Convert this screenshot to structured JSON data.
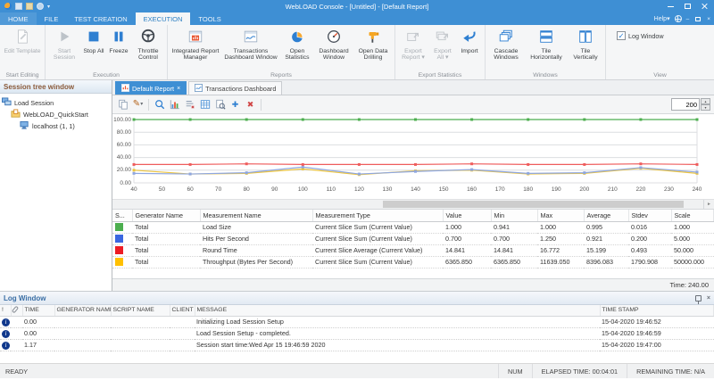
{
  "icons": {
    "caret_down": "▾",
    "caret_up": "▴",
    "close": "×",
    "check": "✓",
    "plus": "✚",
    "cross": "✖",
    "pencil": "✎",
    "info": "i",
    "arrow_right": "►",
    "minimize": "–"
  },
  "titlebar": {
    "title": "WebLOAD Console - [Untitled] - [Default Report]"
  },
  "ribbon": {
    "tabs": [
      {
        "label": "HOME"
      },
      {
        "label": "FILE"
      },
      {
        "label": "TEST CREATION"
      },
      {
        "label": "EXECUTION",
        "active": true
      },
      {
        "label": "TOOLS"
      }
    ],
    "help_label": "Help",
    "groups": [
      {
        "label": "Start Editing",
        "buttons": [
          {
            "label": "Edit Template",
            "disabled": true
          }
        ]
      },
      {
        "label": "Execution",
        "buttons": [
          {
            "label": "Start Session",
            "disabled": true
          },
          {
            "label": "Stop All"
          },
          {
            "label": "Freeze"
          },
          {
            "label": "Throttle Control"
          }
        ]
      },
      {
        "label": "Reports",
        "buttons": [
          {
            "label": "Integrated Report Manager"
          },
          {
            "label": "Transactions Dashboard Window"
          },
          {
            "label": "Open Statistics"
          },
          {
            "label": "Dashboard Window"
          },
          {
            "label": "Open Data Drilling"
          }
        ]
      },
      {
        "label": "Export Statistics",
        "buttons": [
          {
            "label": "Export Report ▾",
            "disabled": true
          },
          {
            "label": "Export All ▾",
            "disabled": true
          },
          {
            "label": "Import"
          }
        ]
      },
      {
        "label": "Windows",
        "buttons": [
          {
            "label": "Cascade Windows"
          },
          {
            "label": "Tile Horizontally"
          },
          {
            "label": "Tile Vertically"
          }
        ]
      },
      {
        "label": "View",
        "checkbox": {
          "label": "Log Window",
          "checked": true
        }
      }
    ]
  },
  "sidebar": {
    "title": "Session tree window",
    "tree": [
      {
        "label": "Load Session"
      },
      {
        "label": "WebLOAD_QuickStart"
      },
      {
        "label": "localhost (1, 1)"
      }
    ]
  },
  "doc": {
    "tabs": [
      {
        "label": "Default Report",
        "active": true
      },
      {
        "label": "Transactions Dashboard"
      }
    ],
    "spinner_value": "200",
    "time_label": "Time: 240.00"
  },
  "chart_data": {
    "type": "line",
    "title": "Default Report",
    "xlabel": "",
    "ylabel": "",
    "xlim": [
      40,
      240
    ],
    "ylim": [
      0,
      100
    ],
    "grid": true,
    "legend_position": "table-below",
    "x_ticks": [
      40,
      50,
      60,
      70,
      80,
      90,
      100,
      110,
      120,
      130,
      140,
      150,
      160,
      170,
      180,
      190,
      200,
      210,
      220,
      230,
      240
    ],
    "y_ticks": [
      0,
      20,
      40,
      60,
      80,
      100
    ],
    "x": [
      40,
      60,
      80,
      100,
      120,
      140,
      160,
      180,
      200,
      220,
      240
    ],
    "series": [
      {
        "name": "Throughput (Bytes Per Second)",
        "color": "#edc53f",
        "values": [
          20,
          14,
          15,
          22,
          13,
          19,
          20,
          14,
          15,
          23,
          15
        ]
      },
      {
        "name": "Hits Per Second",
        "color": "#8fa7e0",
        "values": [
          15,
          14,
          16,
          25,
          14,
          18,
          21,
          15,
          16,
          24,
          17
        ]
      },
      {
        "name": "Round Time",
        "color": "#ef5d5d",
        "values": [
          29,
          29,
          30,
          29,
          29,
          29,
          30,
          29,
          29,
          30,
          29
        ]
      },
      {
        "name": "Load Size",
        "color": "#4cae4f",
        "values": [
          100,
          100,
          100,
          100,
          100,
          100,
          100,
          100,
          100,
          100,
          100
        ]
      }
    ]
  },
  "stats_table": {
    "columns": [
      "S...",
      "Generator Name",
      "Measurement Name",
      "Measurement Type",
      "Value",
      "Min",
      "Max",
      "Average",
      "Stdev",
      "Scale"
    ],
    "rows": [
      {
        "color": "#4cae4f",
        "generator": "Total",
        "name": "Load Size",
        "type": "Current Slice Sum (Current Value)",
        "value": "1.000",
        "min": "0.941",
        "max": "1.000",
        "average": "0.995",
        "stdev": "0.016",
        "scale": "1.000"
      },
      {
        "color": "#3a66e0",
        "generator": "Total",
        "name": "Hits Per Second",
        "type": "Current Slice Sum (Current Value)",
        "value": "0.700",
        "min": "0.700",
        "max": "1.250",
        "average": "0.921",
        "stdev": "0.200",
        "scale": "5.000"
      },
      {
        "color": "#ed1c24",
        "generator": "Total",
        "name": "Round Time",
        "type": "Current Slice Average (Current Value)",
        "value": "14.841",
        "min": "14.841",
        "max": "16.772",
        "average": "15.199",
        "stdev": "0.493",
        "scale": "50.000"
      },
      {
        "color": "#ffc000",
        "generator": "Total",
        "name": "Throughput (Bytes Per Second)",
        "type": "Current Slice Sum (Current Value)",
        "value": "6365.850",
        "min": "6365.850",
        "max": "11639.050",
        "average": "8396.083",
        "stdev": "1790.908",
        "scale": "50000.000"
      }
    ]
  },
  "log_window": {
    "title": "Log Window",
    "columns": [
      {
        "label": "!"
      },
      {
        "label": "",
        "icon": "paperclip"
      },
      {
        "label": "TIME"
      },
      {
        "label": "GENERATOR NAME"
      },
      {
        "label": "SCRIPT NAME"
      },
      {
        "label": "CLIENT ..."
      },
      {
        "label": "MESSAGE"
      },
      {
        "label": "TIME STAMP"
      }
    ],
    "rows": [
      {
        "severity": "info",
        "time": "0.00",
        "generator": "",
        "script": "",
        "client": "",
        "message": "Initializing Load Session Setup",
        "timestamp": "15-04-2020 19:46:52"
      },
      {
        "severity": "info",
        "time": "0.00",
        "generator": "",
        "script": "",
        "client": "",
        "message": "Load Session Setup - completed.",
        "timestamp": "15-04-2020 19:46:59"
      },
      {
        "severity": "info",
        "time": "1.17",
        "generator": "",
        "script": "",
        "client": "",
        "message": "Session start time:Wed Apr 15 19:46:59 2020",
        "timestamp": "15-04-2020 19:47:00"
      }
    ]
  },
  "status_bar": {
    "ready": "READY",
    "num": "NUM",
    "elapsed": "ELAPSED TIME: 00:04:01",
    "remaining": "REMAINING TIME: N/A"
  }
}
